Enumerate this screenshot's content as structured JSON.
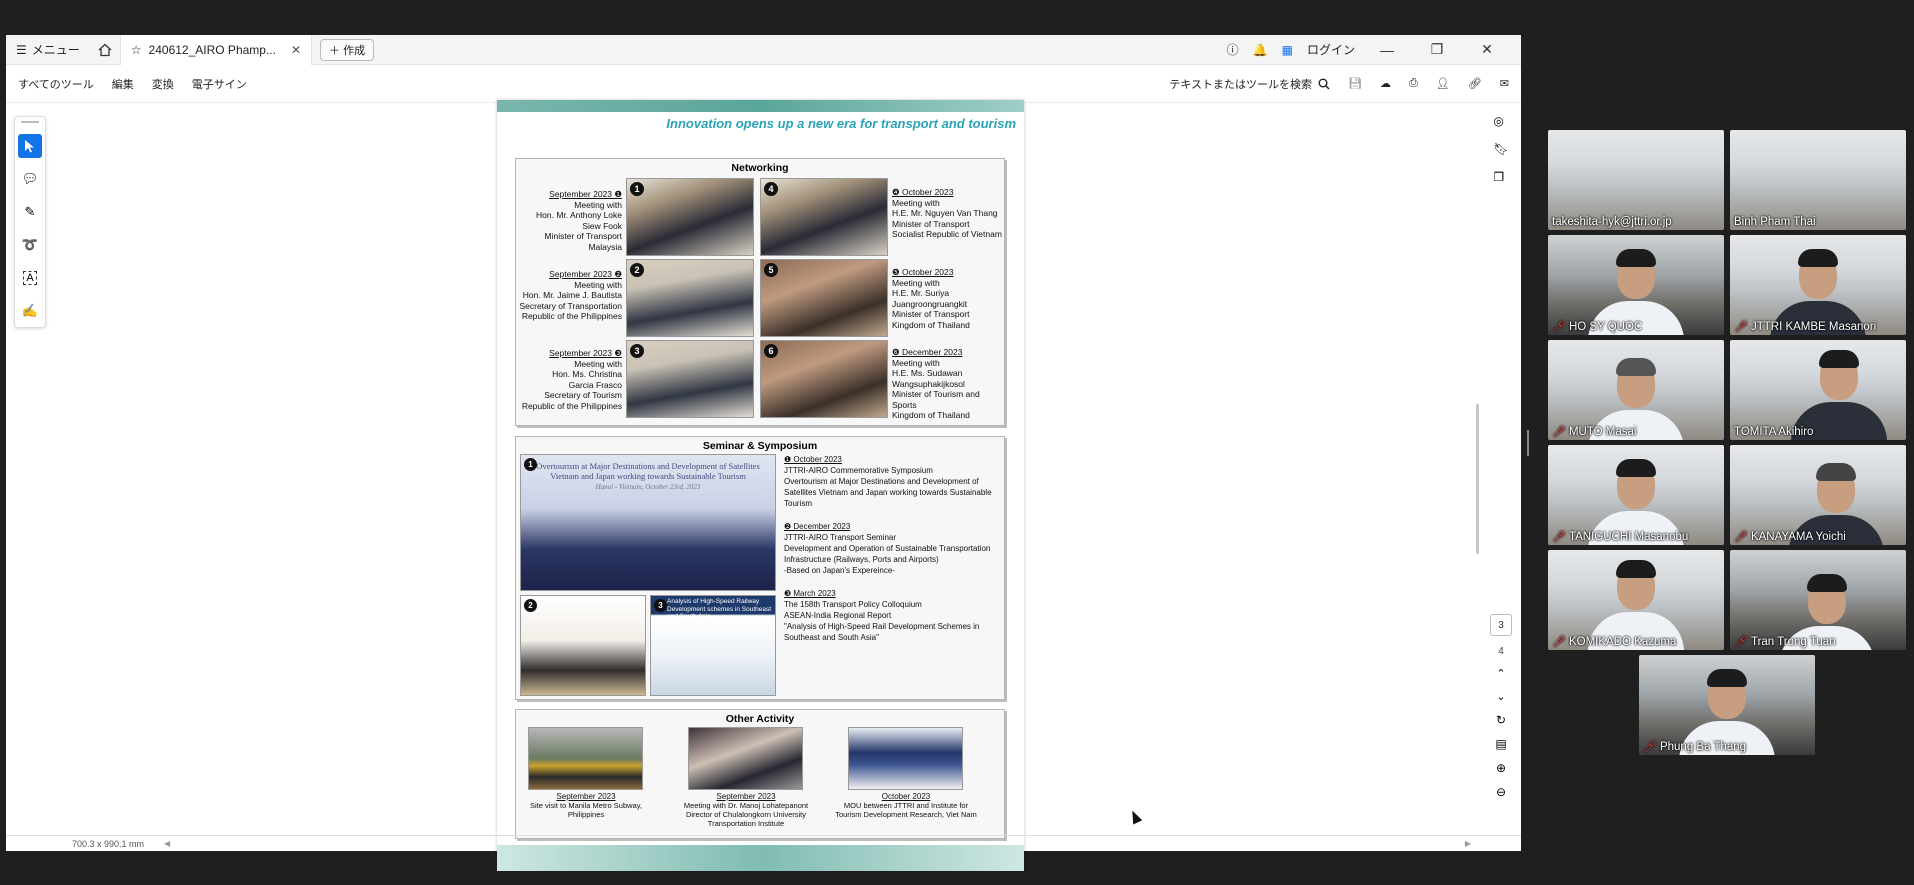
{
  "titlebar": {
    "menu_label": "メニュー",
    "tab_title": "240612_AIRO Phamp...",
    "create_label": "作成",
    "login_label": "ログイン"
  },
  "toolbar": {
    "items": [
      "すべてのツール",
      "編集",
      "変換",
      "電子サイン"
    ],
    "search_label": "テキストまたはツールを検索"
  },
  "page_nav": {
    "current": "3",
    "total": "4"
  },
  "statusbar": {
    "dimensions": "700.3 x 990.1 mm"
  },
  "document": {
    "tagline": "Innovation opens up a new era for transport and tourism",
    "networking": {
      "title": "Networking",
      "items": [
        {
          "num": "1",
          "date": "September 2023 ❶",
          "text": "Meeting with\nHon. Mr. Anthony Loke\nSiew Fook\nMinister of Transport\nMalaysia"
        },
        {
          "num": "2",
          "date": "September 2023 ❷",
          "text": "Meeting with\nHon. Mr. Jaime J. Bautista\nSecretary of Transportation\nRepublic of the Philippines"
        },
        {
          "num": "3",
          "date": "September 2023 ❸",
          "text": "Meeting with\nHon. Ms. Christina\nGarcia Frasco\nSecretary of Tourism\nRepublic of the Philippines"
        },
        {
          "num": "4",
          "date": "❹ October 2023",
          "text": "Meeting with\nH.E. Mr. Nguyen Van Thang\nMinister of Transport\nSocialist Republic of Vietnam"
        },
        {
          "num": "5",
          "date": "❺ October 2023",
          "text": "Meeting with\nH.E. Mr. Suriya\nJuangroongruangkit\nMinister of Transport\nKingdom of Thailand"
        },
        {
          "num": "6",
          "date": "❻ December 2023",
          "text": "Meeting with\nH.E. Ms. Sudawan\nWangsuphakijkosol\nMinister of Tourism and Sports\nKingdom of Thailand"
        }
      ]
    },
    "seminar": {
      "title": "Seminar & Symposium",
      "banner": "Overtourism at Major Destinations and Development of Satellites Vietnam and Japan working towards Sustainable Tourism",
      "banner_sub": "Hanoi - Vietnam, October 23rd, 2023",
      "photo3_caption": "Analysis of High-Speed Railway Development schemes in Southeast and South Asia",
      "entries": [
        {
          "date": "❶ October 2023",
          "text": "JTTRI-AIRO Commemorative Symposium\nOvertourism at Major Destinations and Development of Satellites Vietnam and Japan working towards Sustainable Tourism"
        },
        {
          "date": "❷ December 2023",
          "text": "JTTRI-AIRO Transport Seminar\nDevelopment and Operation of Sustainable Transportation Infrastructure (Railways, Ports and Airports)\n-Based on Japan's Expereince-"
        },
        {
          "date": "❸ March 2023",
          "text": "The 158th Transport Policy Colloquium\nASEAN-India Regional Report\n\"Analysis of High-Speed Rail Development Schemes in Southeast and South Asia\""
        }
      ]
    },
    "other": {
      "title": "Other Activity",
      "items": [
        {
          "date": "September 2023",
          "text": "Site visit to Manila Metro Subway, Philippines"
        },
        {
          "date": "September 2023",
          "text": "Meeting with Dr. Manoj Lohatepanont Director of Chulalongkorn University Transportation Institute"
        },
        {
          "date": "October 2023",
          "text": "MOU between JTTRI and Institute for Tourism Development Research, Viet Nam"
        }
      ]
    }
  },
  "participants": [
    {
      "name": "takeshita-hyk@jttri.or.jp",
      "muted": false
    },
    {
      "name": "Binh Pham Thai",
      "muted": false
    },
    {
      "name": "HO SY QUOC",
      "muted": true
    },
    {
      "name": "JTTRI KAMBE Masanori",
      "muted": true
    },
    {
      "name": "MUTO Masai",
      "muted": true
    },
    {
      "name": "TOMITA Akihiro",
      "muted": false
    },
    {
      "name": "TANIGUCHI Masanobu",
      "muted": true
    },
    {
      "name": "KANAYAMA Yoichi",
      "muted": true
    },
    {
      "name": "KOMIKADO Kazuma",
      "muted": true
    },
    {
      "name": "Tran Trong Tuan",
      "muted": true
    },
    {
      "name": "Phung Ba Thang",
      "muted": true
    }
  ]
}
